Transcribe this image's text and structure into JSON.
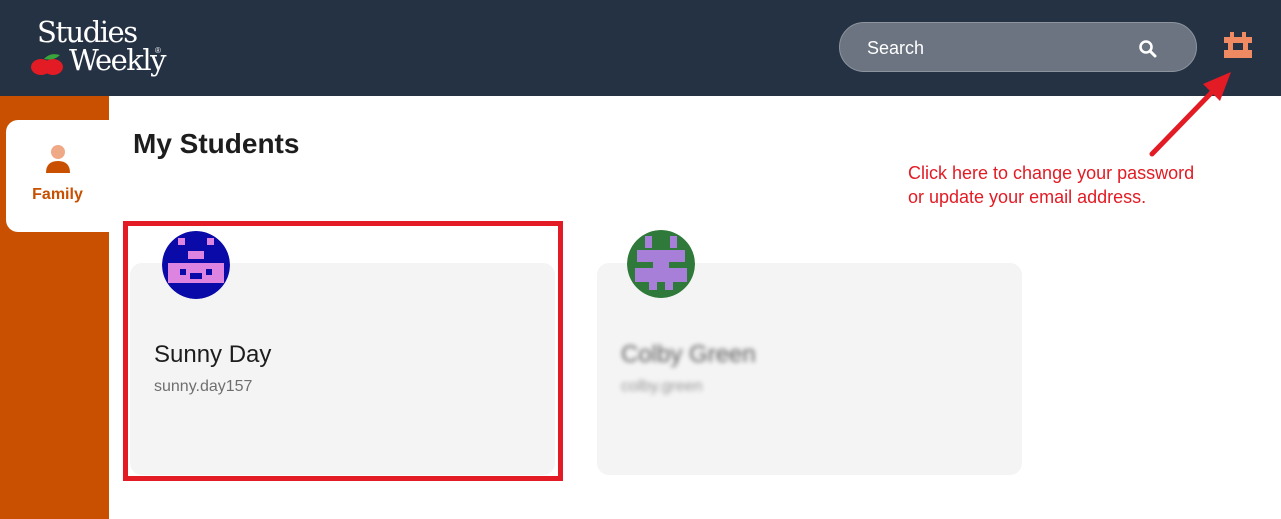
{
  "brand": {
    "line1": "Studies",
    "line2": "Weekly",
    "reg_mark": "®"
  },
  "search": {
    "placeholder": "Search"
  },
  "sidebar": {
    "items": [
      {
        "label": "Family",
        "icon": "person-icon",
        "active": true
      }
    ]
  },
  "page": {
    "title": "My Students"
  },
  "annotation": {
    "line1": "Click here to change your password",
    "line2": "or update your email address."
  },
  "students": [
    {
      "name": "Sunny Day",
      "username": "sunny.day157",
      "avatar": "robot-blue-avatar",
      "highlighted": true
    },
    {
      "name": "Colby Green",
      "username": "colby.green",
      "avatar": "robot-green-avatar",
      "blurred": true
    }
  ],
  "colors": {
    "topbar": "#253244",
    "sidebar": "#c85000",
    "annotation": "#e21b24",
    "account_icon": "#f08a63"
  }
}
